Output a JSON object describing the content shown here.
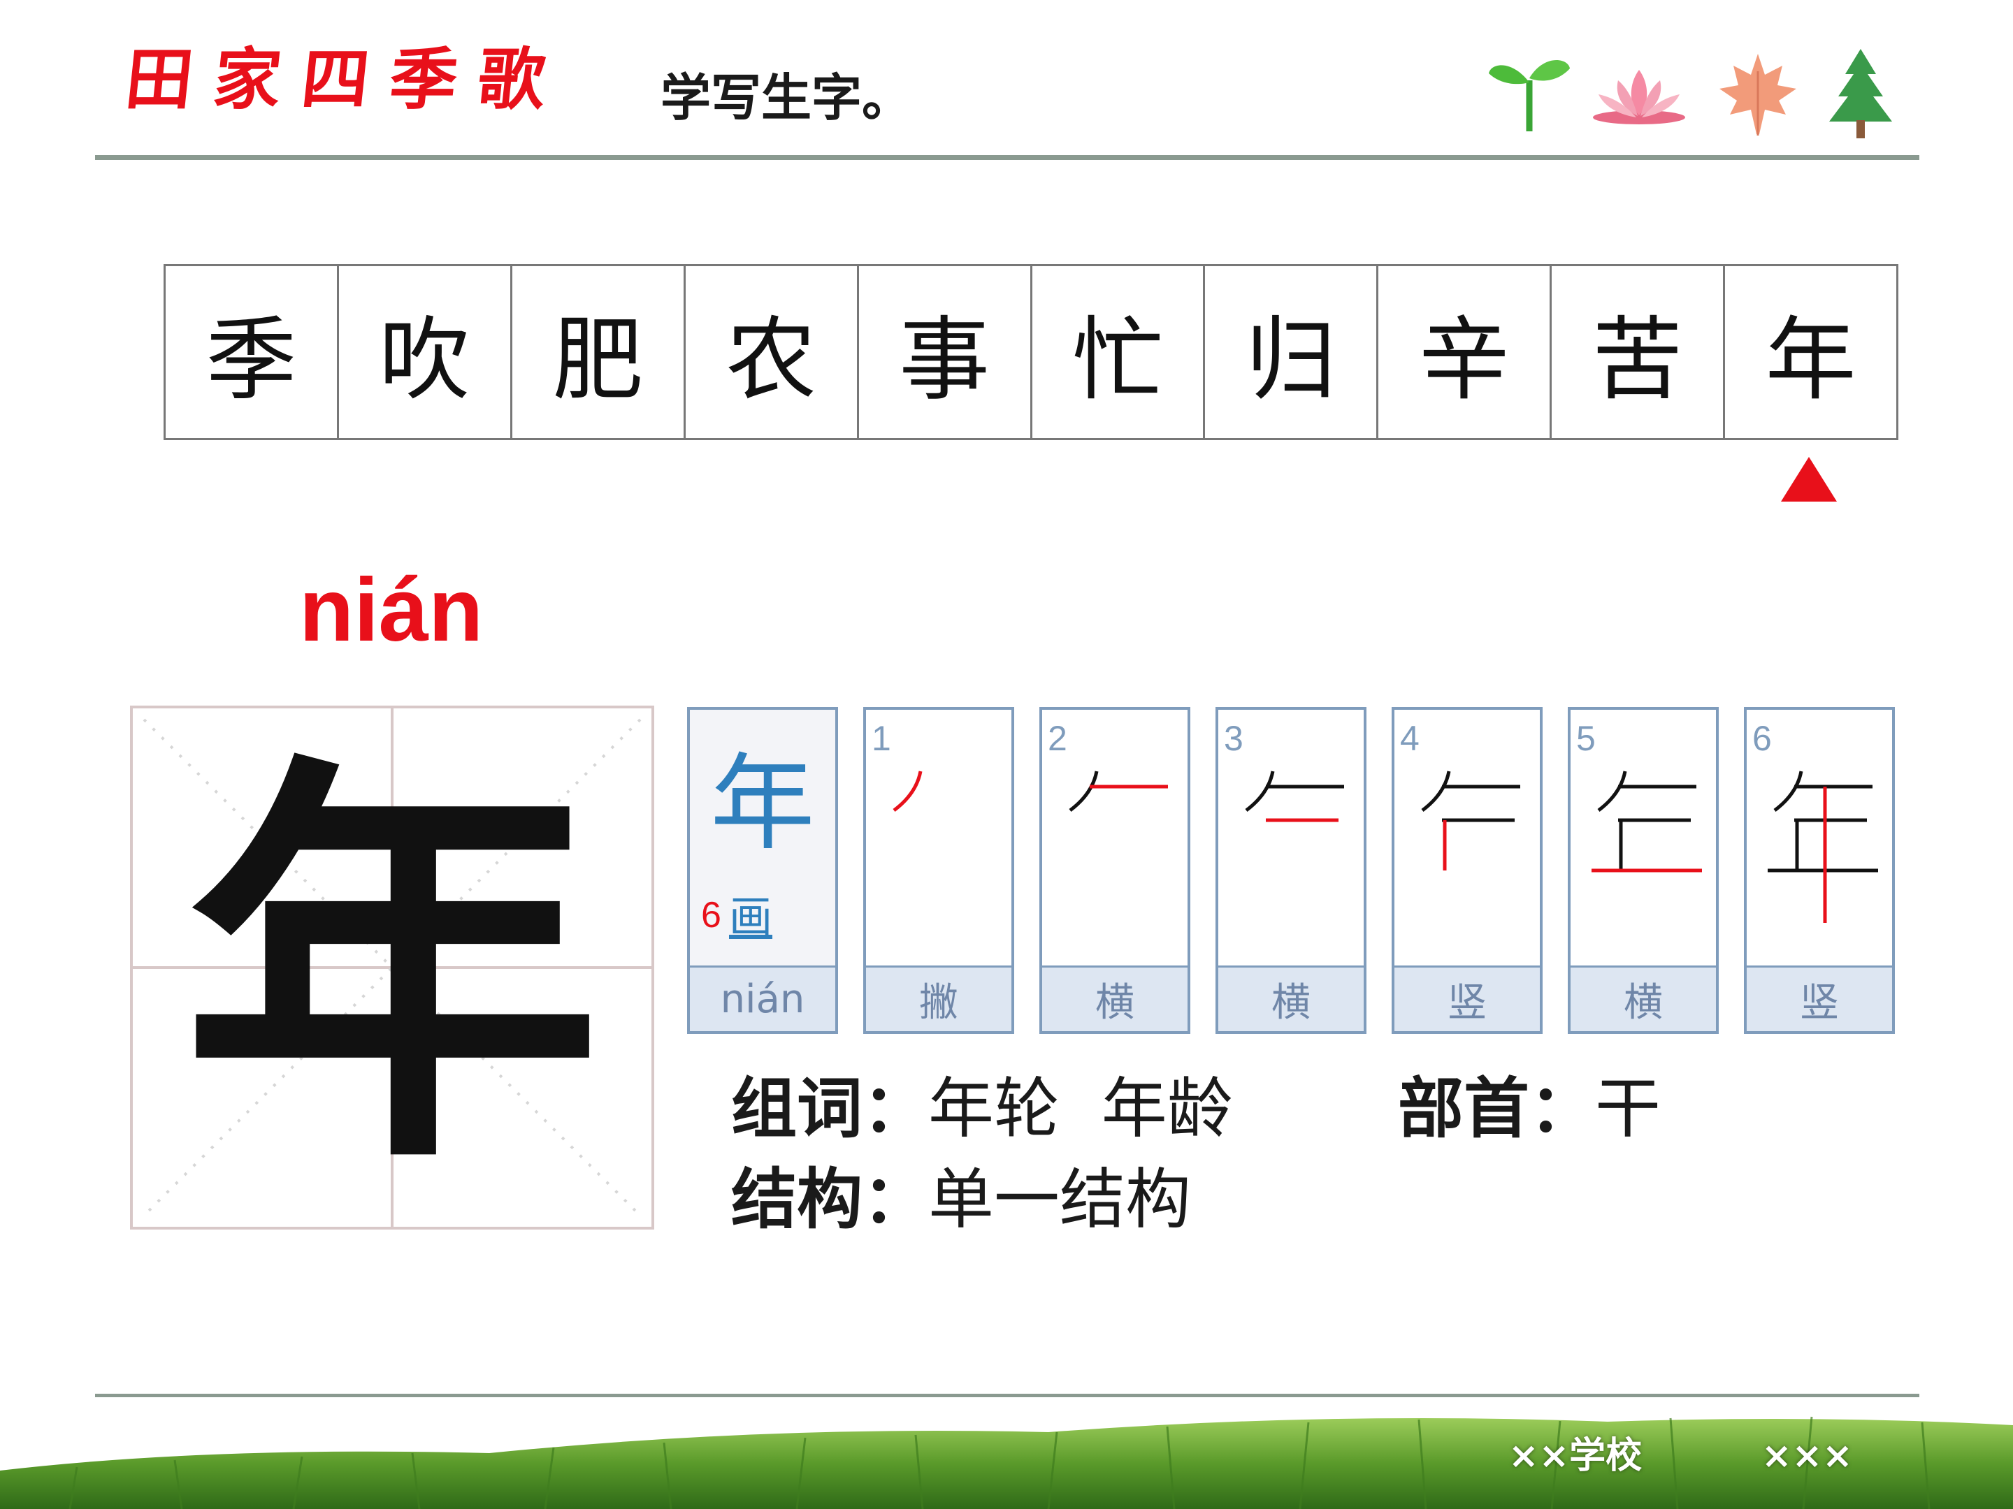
{
  "header": {
    "title": "田家四季歌",
    "subtitle": "学写生字。"
  },
  "strip": {
    "characters": [
      "季",
      "吹",
      "肥",
      "农",
      "事",
      "忙",
      "归",
      "辛",
      "苦",
      "年"
    ],
    "selected_index": 9
  },
  "detail": {
    "pinyin": "nián",
    "character": "年",
    "info_card": {
      "character": "年",
      "stroke_count": "6",
      "bushou_label": "画",
      "pinyin": "nián"
    },
    "strokes": [
      {
        "number": "1",
        "name": "撇"
      },
      {
        "number": "2",
        "name": "横"
      },
      {
        "number": "3",
        "name": "横"
      },
      {
        "number": "4",
        "name": "竖"
      },
      {
        "number": "5",
        "name": "横"
      },
      {
        "number": "6",
        "name": "竖"
      }
    ]
  },
  "words": {
    "label": "组词：",
    "value": "年轮  年龄"
  },
  "radical": {
    "label": "部首：",
    "value": "干"
  },
  "structure": {
    "label": "结构：",
    "value": "单一结构"
  },
  "footer": {
    "school": "××学校",
    "name": "×××"
  },
  "colors": {
    "accent_red": "#e8101a",
    "stroke_blue": "#7f9cbc",
    "rule_gray": "#8a9a90"
  }
}
